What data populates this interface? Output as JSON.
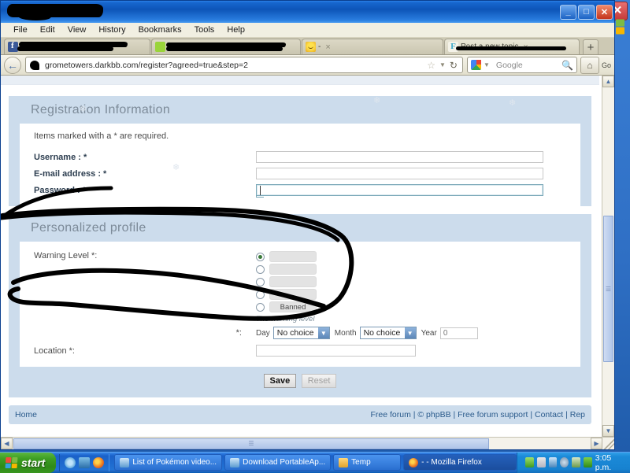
{
  "window": {
    "title_redacted": true,
    "buttons": {
      "minimize": "_",
      "maximize": "□",
      "close": "✕"
    }
  },
  "desktop": {
    "close_label": "✕"
  },
  "menubar": {
    "items": [
      {
        "label": "File"
      },
      {
        "label": "Edit"
      },
      {
        "label": "View"
      },
      {
        "label": "History"
      },
      {
        "label": "Bookmarks"
      },
      {
        "label": "Tools"
      },
      {
        "label": "Help"
      }
    ]
  },
  "tabs": {
    "items": [
      {
        "title": "",
        "redacted": true,
        "icon": "facebook-icon",
        "active": false
      },
      {
        "title": "",
        "redacted": true,
        "icon": "green-bubble-icon",
        "active": false
      },
      {
        "title": "-",
        "redacted": false,
        "icon": "smiley-icon",
        "active": false
      },
      {
        "title": "Post a new topic",
        "redacted": true,
        "icon": "forum-icon",
        "active": true
      }
    ],
    "new_tab_label": "+",
    "close_label": "×"
  },
  "navbar": {
    "back_label": "←",
    "url": "grometowers.darkbb.com/register?agreed=true&step=2",
    "url_icon": "site-favicon",
    "bookmark_icon": "☆",
    "dropdown_icon": "▼",
    "reload_icon": "↻",
    "search_engine": "Google",
    "search_placeholder": "Google",
    "search_icon": "magnifier-icon",
    "home_icon": "⌂",
    "go_label": "Go"
  },
  "page": {
    "registration": {
      "heading": "Registration Information",
      "note": "Items marked with a * are required.",
      "fields": [
        {
          "label": "Username : *",
          "value": "",
          "focused": false
        },
        {
          "label": "E-mail address : *",
          "value": "",
          "focused": false
        },
        {
          "label": "Password : *",
          "value": "",
          "focused": true
        }
      ]
    },
    "profile": {
      "heading": "Personalized profile",
      "warning_level": {
        "label": "Warning Level *:",
        "help": "The warning level",
        "options": [
          {
            "fill_percent": 100,
            "color": "#94c83d",
            "label": "",
            "selected": true
          },
          {
            "fill_percent": 75,
            "color": "#e5e04b",
            "label": "",
            "selected": false
          },
          {
            "fill_percent": 55,
            "color": "#e8c65c",
            "label": "",
            "selected": false
          },
          {
            "fill_percent": 28,
            "color": "#e07273",
            "label": "",
            "selected": false
          },
          {
            "fill_percent": 0,
            "color": "#e3e3e3",
            "label": "Banned",
            "selected": false
          }
        ]
      },
      "birthday": {
        "label": "*:",
        "day_label": "Day",
        "day_value": "No choice",
        "month_label": "Month",
        "month_value": "No choice",
        "year_label": "Year",
        "year_value": "0"
      },
      "location": {
        "label": "Location *:",
        "value": ""
      }
    },
    "buttons": {
      "save": "Save",
      "reset": "Reset"
    },
    "footer": {
      "home": "Home",
      "links": "Free forum | © phpBB | Free forum support | Contact | Rep"
    }
  },
  "taskbar": {
    "start_label": "start",
    "tasks": [
      {
        "label": "List of Pokémon video...",
        "active": false
      },
      {
        "label": "Download PortableAp...",
        "active": false
      },
      {
        "label": "Temp",
        "active": false
      },
      {
        "label": "- - Mozilla Firefox",
        "active": true
      }
    ],
    "clock": "3:05 p.m."
  }
}
